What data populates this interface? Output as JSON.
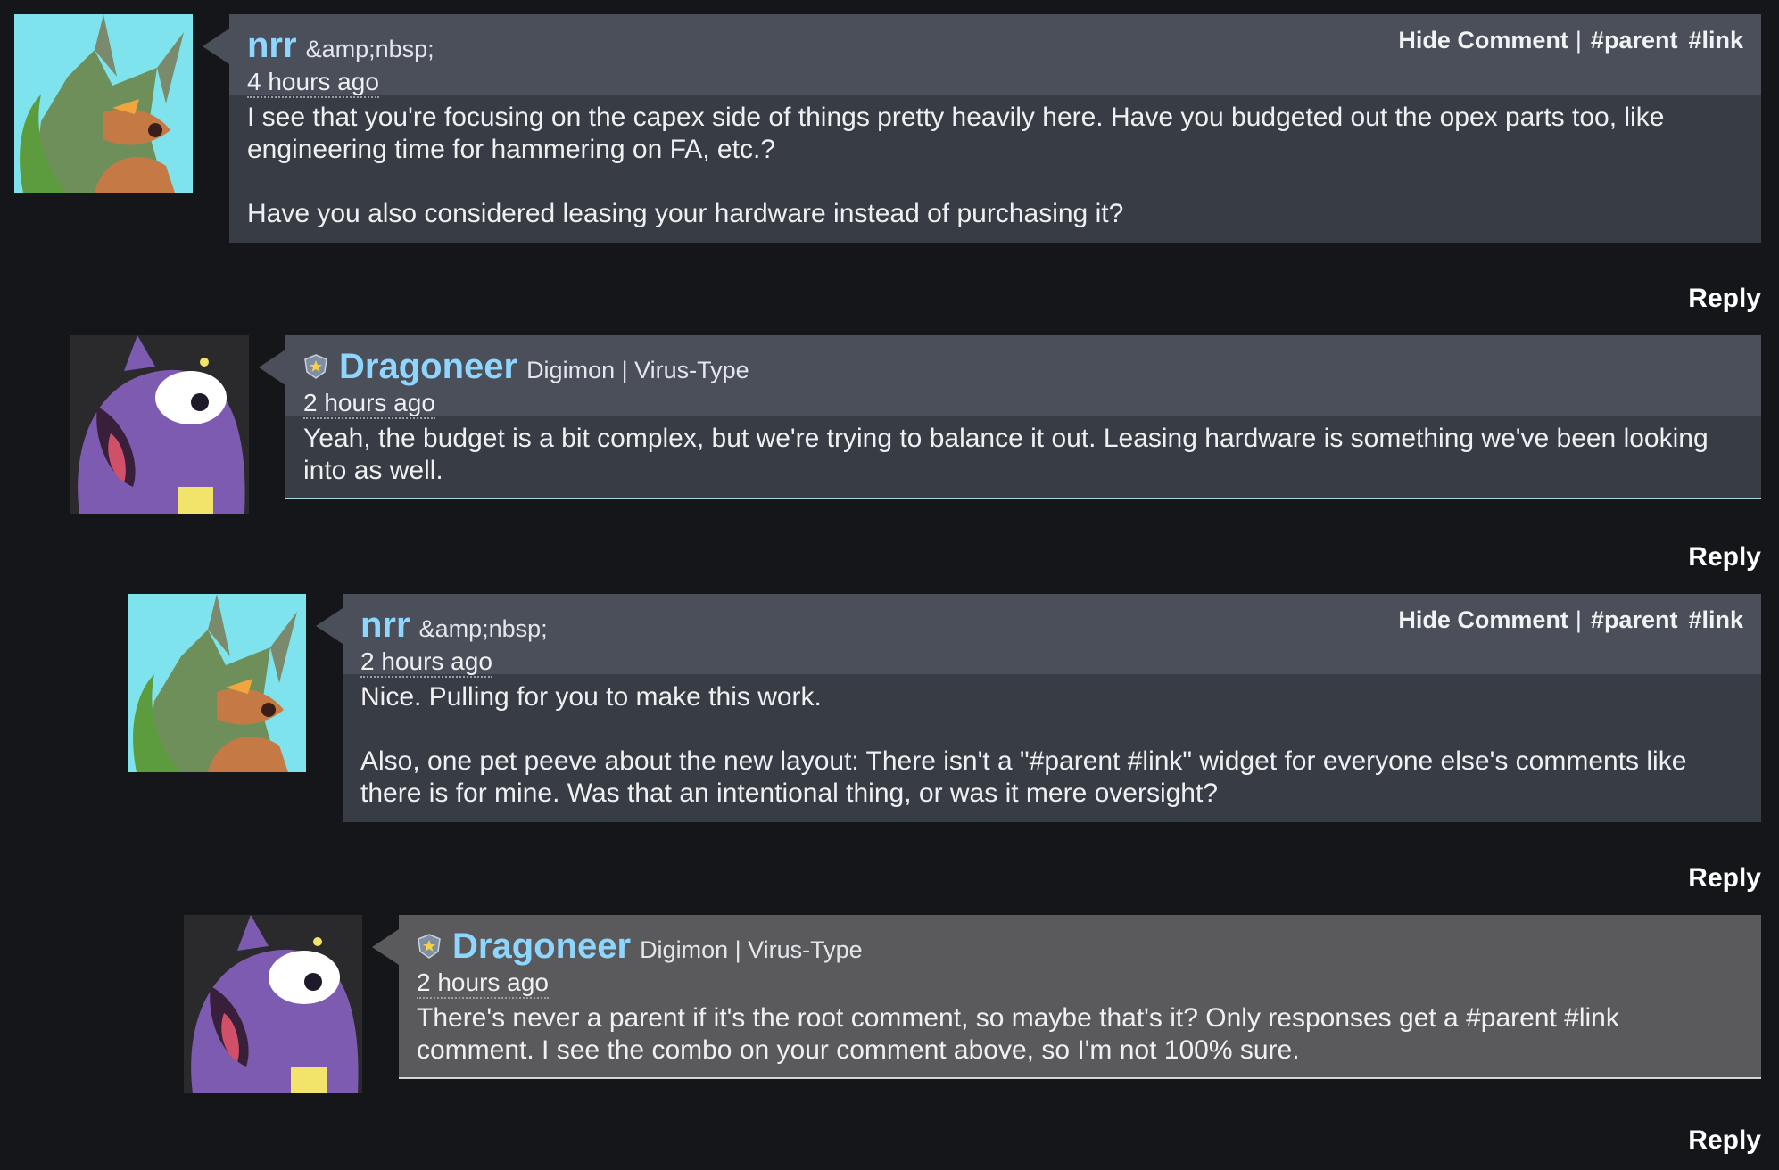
{
  "comments": [
    {
      "user": "nrr",
      "user_title": "&amp;nbsp;",
      "time": "4 hours ago",
      "paragraphs": [
        "I see that you're focusing on the capex side of things pretty heavily here. Have you budgeted out the opex parts too, like engineering time for hammering on FA, etc.?",
        "Have you also considered leasing your hardware instead of purchasing it?"
      ],
      "links": {
        "hide": "Hide Comment",
        "sep": "|",
        "parent": "#parent",
        "link": "#link"
      },
      "reply": "Reply",
      "avatar_icon": "fox-avatar-icon"
    },
    {
      "user": "Dragoneer",
      "user_title": "Digimon | Virus-Type",
      "time": "2 hours ago",
      "paragraphs": [
        "Yeah, the budget is a bit complex, but we're trying to balance it out. Leasing hardware is something we've been looking into as well."
      ],
      "reply": "Reply",
      "avatar_icon": "dragon-avatar-icon",
      "badge_icon": "staff-badge-icon"
    },
    {
      "user": "nrr",
      "user_title": "&amp;nbsp;",
      "time": "2 hours ago",
      "paragraphs": [
        "Nice. Pulling for you to make this work.",
        "Also, one pet peeve about the new layout: There isn't a \"#parent #link\" widget for everyone else's comments like there is for mine. Was that an intentional thing, or was it mere oversight?"
      ],
      "links": {
        "hide": "Hide Comment",
        "sep": "|",
        "parent": "#parent",
        "link": "#link"
      },
      "reply": "Reply",
      "avatar_icon": "fox-avatar-icon"
    },
    {
      "user": "Dragoneer",
      "user_title": "Digimon | Virus-Type",
      "time": "2 hours ago",
      "paragraphs": [
        "There's never a parent if it's the root comment, so maybe that's it? Only responses get a #parent #link comment. I see the combo on your comment above, so I'm not 100% sure."
      ],
      "reply": "Reply",
      "avatar_icon": "dragon-avatar-icon",
      "badge_icon": "staff-badge-icon"
    }
  ],
  "colors": {
    "background": "#151619",
    "header": "#4a4f59",
    "body": "#383c44",
    "username": "#8fd6ff",
    "highlight": "#5a5a5c"
  }
}
